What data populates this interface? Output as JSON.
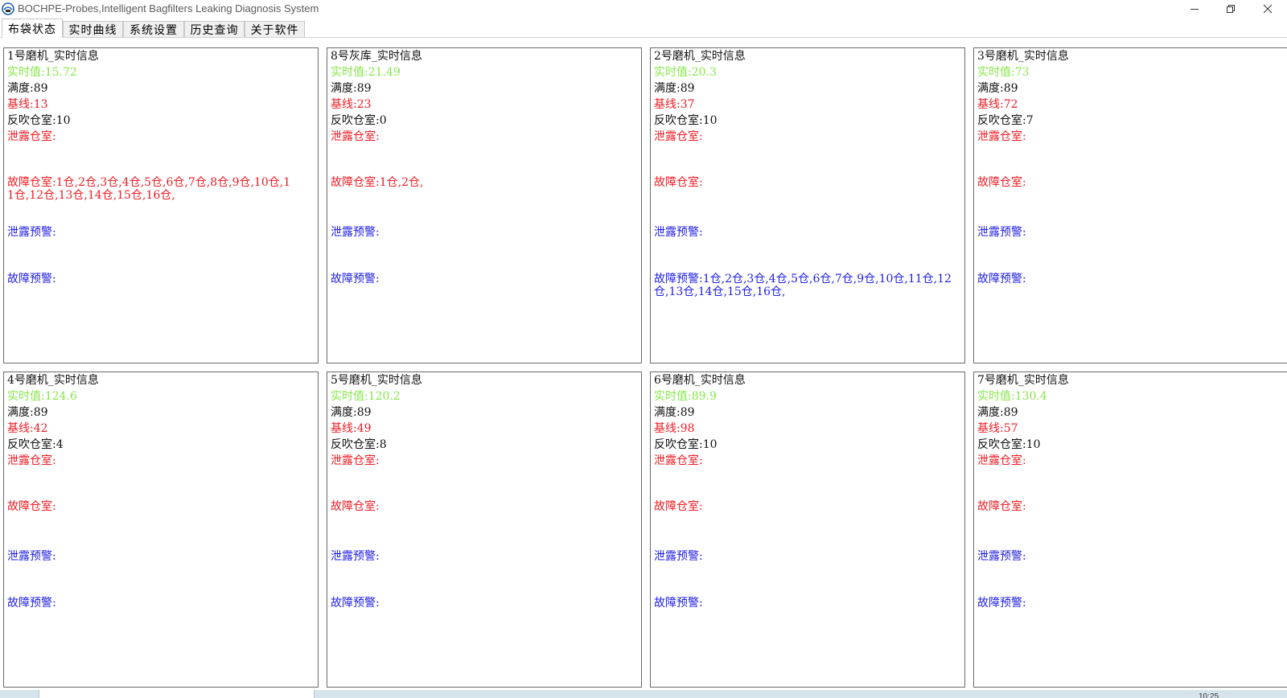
{
  "window": {
    "title": "BOCHPE-Probes,Intelligent Bagfilters Leaking Diagnosis System",
    "icon": "app-logo-icon",
    "controls": [
      "minimize-icon",
      "restore-icon",
      "close-icon"
    ]
  },
  "tabs": [
    {
      "label": "布袋状态",
      "active": true
    },
    {
      "label": "实时曲线",
      "active": false
    },
    {
      "label": "系统设置",
      "active": false
    },
    {
      "label": "历史查询",
      "active": false
    },
    {
      "label": "关于软件",
      "active": false
    }
  ],
  "colors": {
    "realtime": "#86e64a",
    "alarm": "#ee1c24",
    "warning": "#1e1ee6",
    "text": "#111111",
    "panel_border": "#6b6b6b"
  },
  "panels": [
    {
      "title": "1号磨机_实时信息",
      "realtime": "实时值:15.72",
      "full": "满度:89",
      "baseline": "基线:13",
      "pulse": "反吹仓室:10",
      "leak": "泄露仓室:",
      "fault": "故障仓室:1仓,2仓,3仓,4仓,5仓,6仓,7仓,8仓,9仓,10仓,11仓,12仓,13仓,14仓,15仓,16仓,",
      "leak_warn": "泄露预警:",
      "fault_warn": "故障预警:"
    },
    {
      "title": "8号灰库_实时信息",
      "realtime": "实时值:21.49",
      "full": "满度:89",
      "baseline": "基线:23",
      "pulse": "反吹仓室:0",
      "leak": "泄露仓室:",
      "fault": "故障仓室:1仓,2仓,",
      "leak_warn": "泄露预警:",
      "fault_warn": "故障预警:"
    },
    {
      "title": "2号磨机_实时信息",
      "realtime": "实时值:20.3",
      "full": "满度:89",
      "baseline": "基线:37",
      "pulse": "反吹仓室:10",
      "leak": "泄露仓室:",
      "fault": "故障仓室:",
      "leak_warn": "泄露预警:",
      "fault_warn": "故障预警:1仓,2仓,3仓,4仓,5仓,6仓,7仓,9仓,10仓,11仓,12仓,13仓,14仓,15仓,16仓,"
    },
    {
      "title": "3号磨机_实时信息",
      "realtime": "实时值:73",
      "full": "满度:89",
      "baseline": "基线:72",
      "pulse": "反吹仓室:7",
      "leak": "泄露仓室:",
      "fault": "故障仓室:",
      "leak_warn": "泄露预警:",
      "fault_warn": "故障预警:"
    },
    {
      "title": "4号磨机_实时信息",
      "realtime": "实时值:124.6",
      "full": "满度:89",
      "baseline": "基线:42",
      "pulse": "反吹仓室:4",
      "leak": "泄露仓室:",
      "fault": "故障仓室:",
      "leak_warn": "泄露预警:",
      "fault_warn": "故障预警:"
    },
    {
      "title": "5号磨机_实时信息",
      "realtime": "实时值:120.2",
      "full": "满度:89",
      "baseline": "基线:49",
      "pulse": "反吹仓室:8",
      "leak": "泄露仓室:",
      "fault": "故障仓室:",
      "leak_warn": "泄露预警:",
      "fault_warn": "故障预警:"
    },
    {
      "title": "6号磨机_实时信息",
      "realtime": "实时值:89.9",
      "full": "满度:89",
      "baseline": "基线:98",
      "pulse": "反吹仓室:10",
      "leak": "泄露仓室:",
      "fault": "故障仓室:",
      "leak_warn": "泄露预警:",
      "fault_warn": "故障预警:"
    },
    {
      "title": "7号磨机_实时信息",
      "realtime": "实时值:130.4",
      "full": "满度:89",
      "baseline": "基线:57",
      "pulse": "反吹仓室:10",
      "leak": "泄露仓室:",
      "fault": "故障仓室:",
      "leak_warn": "泄露预警:",
      "fault_warn": "故障预警:"
    }
  ],
  "taskbar": {
    "clock": "10:25"
  }
}
